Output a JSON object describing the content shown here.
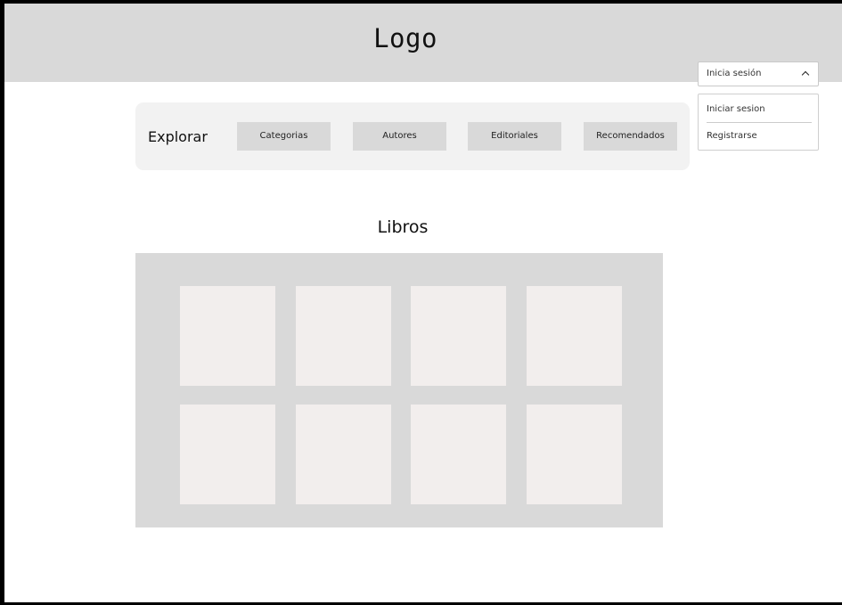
{
  "header": {
    "logo_text": "Logo"
  },
  "login_menu": {
    "label": "Inicia sesión",
    "options": [
      "Iniciar sesion",
      "Registrarse"
    ]
  },
  "explore": {
    "label": "Explorar",
    "buttons": [
      "Categorias",
      "Autores",
      "Editoriales",
      "Recomendados"
    ]
  },
  "books": {
    "title": "Libros",
    "card_count": 8
  },
  "colors": {
    "header_bg": "#d9d9d9",
    "explore_bg": "#f2f2f2",
    "nav_button_bg": "#d9d9d9",
    "grid_bg": "#d9d9d9",
    "card_bg": "#f2eeed"
  }
}
